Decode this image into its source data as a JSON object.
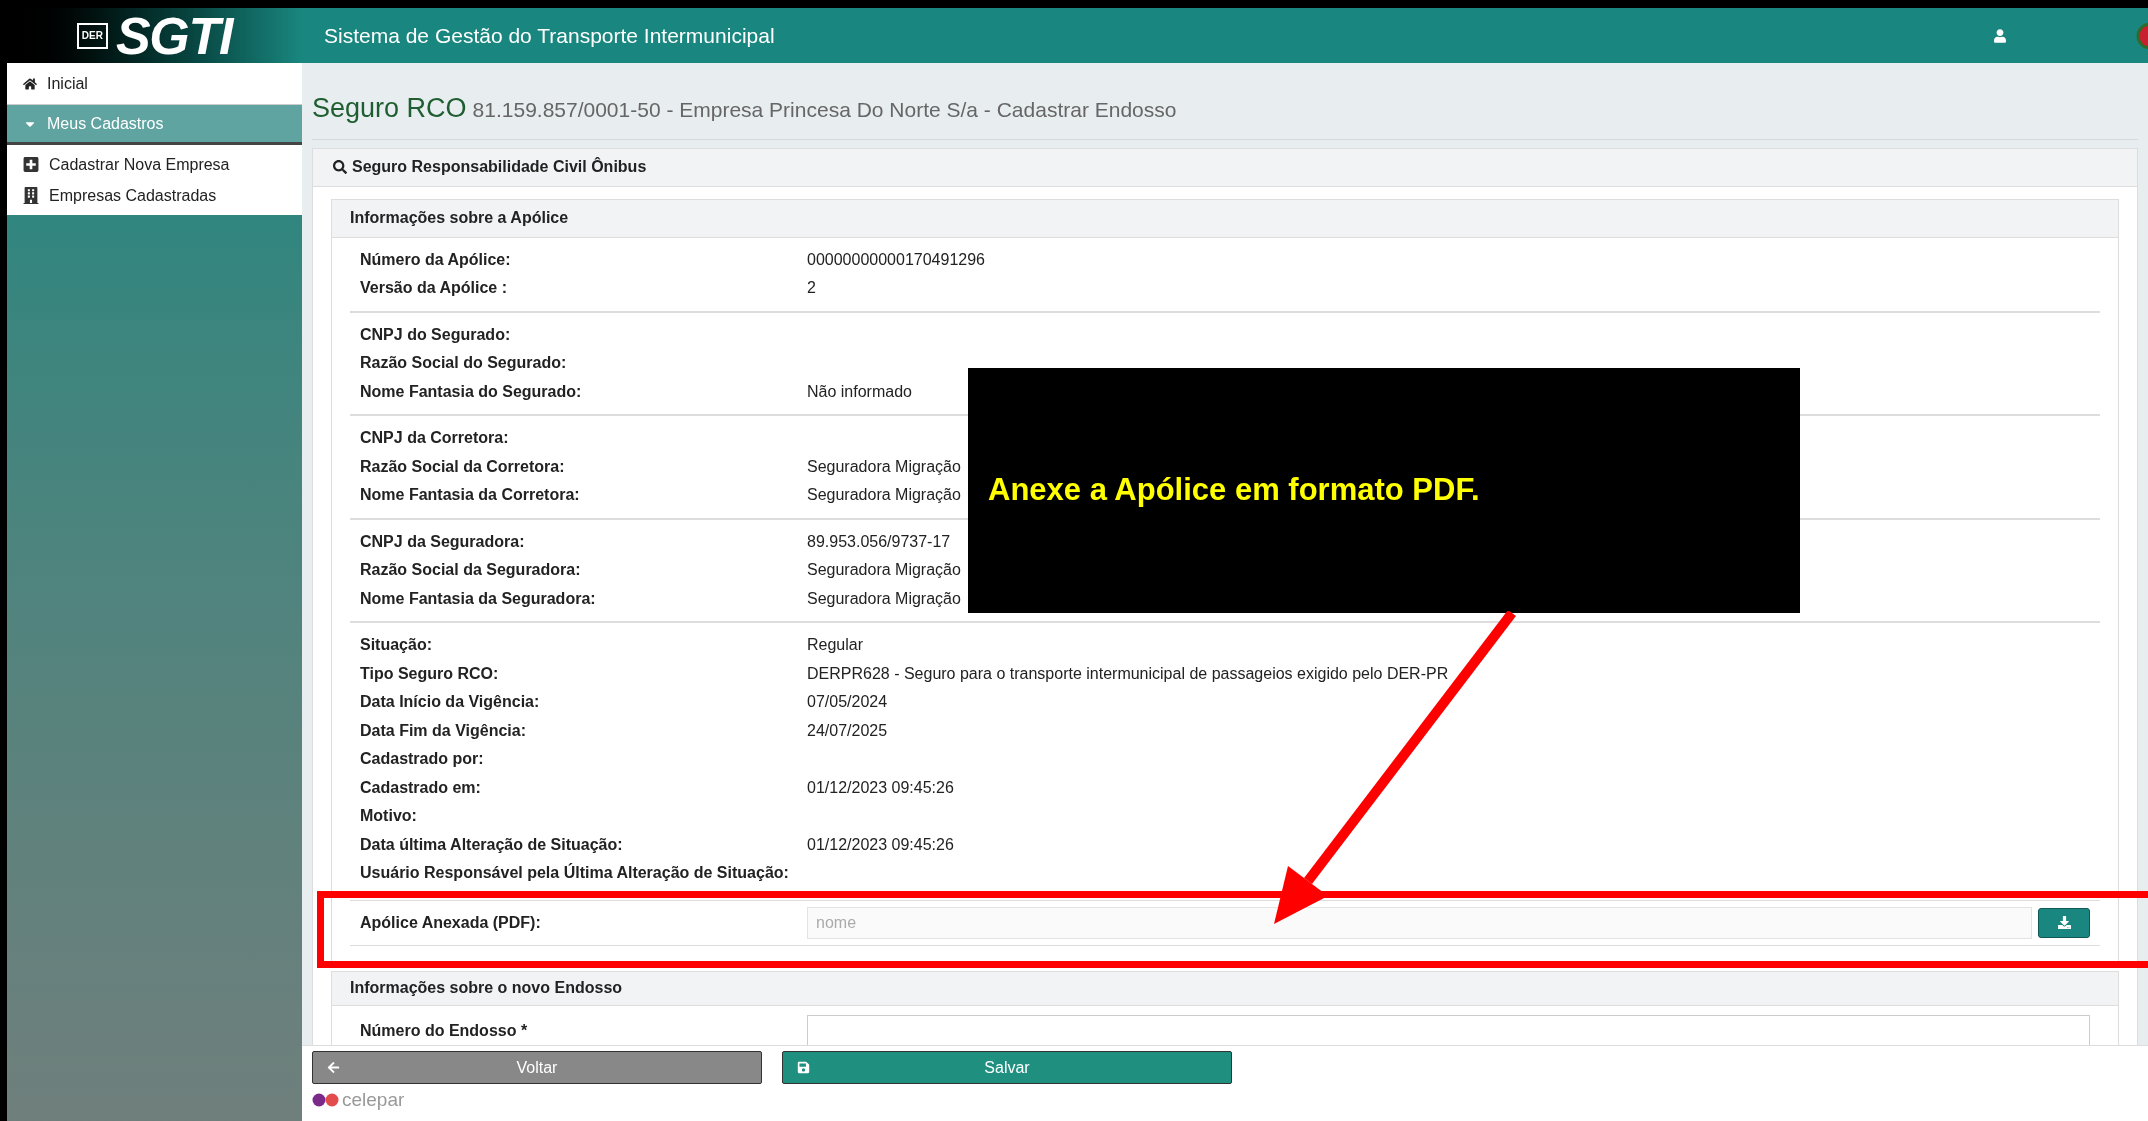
{
  "header": {
    "logo": "SGTI",
    "logo_emblem": "DER",
    "title": "Sistema de Gestão do Transporte Intermunicipal"
  },
  "sidebar": {
    "items": [
      {
        "label": "Inicial",
        "selected": false
      },
      {
        "label": "Meus Cadastros",
        "selected": true,
        "expanded": true,
        "children": [
          {
            "label": "Cadastrar Nova Empresa"
          },
          {
            "label": "Empresas Cadastradas"
          }
        ]
      }
    ]
  },
  "page": {
    "title": "Seguro RCO",
    "subtitle": "81.159.857/0001-50 - Empresa Princesa Do Norte S/a - Cadastrar Endosso"
  },
  "panel": {
    "title": "Seguro Responsabilidade Civil Ônibus",
    "policy": {
      "title": "Informações sobre a Apólice",
      "groups": [
        [
          {
            "label": "Número da Apólice:",
            "value": "00000000000170491296"
          },
          {
            "label": "Versão da Apólice :",
            "value": "2"
          }
        ],
        [
          {
            "label": "CNPJ do Segurado:"
          },
          {
            "label": "Razão Social do Segurado:"
          },
          {
            "label": "Nome Fantasia do Segurado:",
            "value": "Não informado"
          }
        ],
        [
          {
            "label": "CNPJ da Corretora:"
          },
          {
            "label": "Razão Social da Corretora:",
            "value": "Seguradora Migração"
          },
          {
            "label": "Nome Fantasia da Corretora:",
            "value": "Seguradora Migração"
          }
        ],
        [
          {
            "label": "CNPJ da Seguradora:",
            "value": "89.953.056/9737-17"
          },
          {
            "label": "Razão Social da Seguradora:",
            "value": "Seguradora Migração"
          },
          {
            "label": "Nome Fantasia da Seguradora:",
            "value": "Seguradora Migração"
          }
        ],
        [
          {
            "label": "Situação:",
            "value": "Regular"
          },
          {
            "label": "Tipo Seguro RCO:",
            "value": "DERPR628 - Seguro para o transporte intermunicipal de passageios exigido pelo DER-PR"
          },
          {
            "label": "Data Início da Vigência:",
            "value": "07/05/2024"
          },
          {
            "label": "Data Fim da Vigência:",
            "value": "24/07/2025"
          },
          {
            "label": "Cadastrado por:"
          },
          {
            "label": "Cadastrado em:",
            "value": "01/12/2023 09:45:26"
          },
          {
            "label": "Motivo:"
          },
          {
            "label": "Data última Alteração de Situação:",
            "value": "01/12/2023 09:45:26"
          },
          {
            "label": "Usuário Responsável pela Última Alteração de Situação:"
          }
        ]
      ],
      "attachment": {
        "label": "Apólice Anexada (PDF):",
        "placeholder": "nome"
      }
    },
    "endorsement": {
      "title": "Informações sobre o novo Endosso",
      "fields": [
        {
          "label": "Número do Endosso",
          "required_mark": "*"
        }
      ]
    }
  },
  "footer": {
    "buttons": [
      {
        "label": "Voltar",
        "kind": "back"
      },
      {
        "label": "Salvar",
        "kind": "save"
      }
    ],
    "brand": "celepar"
  },
  "annotation": {
    "callout": "Anexe a Apólice em formato PDF."
  }
}
